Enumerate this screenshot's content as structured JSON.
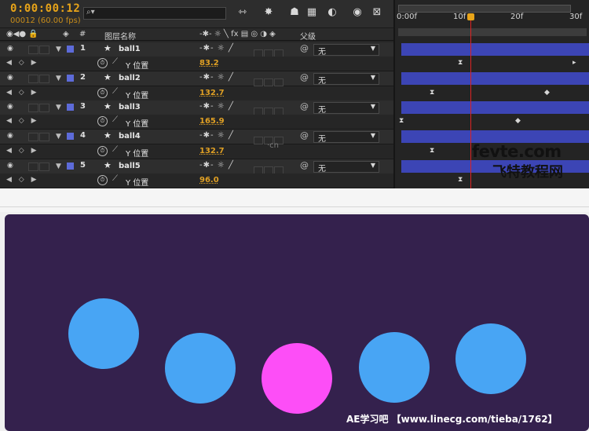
{
  "timecode": "0:00:00:12",
  "timecode_sub": "00012 (60.00 fps)",
  "search_placeholder": "⌕▾",
  "columns": {
    "number": "#",
    "layer_name": "图层名称",
    "parent": "父级"
  },
  "layers": [
    {
      "index": "1",
      "name": "ball1",
      "parent": "无",
      "property": "Y 位置",
      "value": "83.2"
    },
    {
      "index": "2",
      "name": "ball2",
      "parent": "无",
      "property": "Y 位置",
      "value": "132.7"
    },
    {
      "index": "3",
      "name": "ball3",
      "parent": "无",
      "property": "Y 位置",
      "value": "165.9"
    },
    {
      "index": "4",
      "name": "ball4",
      "parent": "无",
      "property": "Y 位置",
      "value": "132.7"
    },
    {
      "index": "5",
      "name": "ball5",
      "parent": "无",
      "property": "Y 位置",
      "value": "96.0"
    }
  ],
  "ruler": {
    "t0": "0:00f",
    "t1": "10f",
    "t2": "20f",
    "t3": "30f"
  },
  "watermark": {
    "line1": "fevte.com",
    "line2": "飞特教程网",
    "center": "·cn"
  },
  "stage_footer": "AE学习吧  【www.linecg.com/tieba/1762】",
  "colors": {
    "stage_bg": "#34214d",
    "ball_blue": "#48a5f4",
    "ball_pink": "#fd4ef7",
    "layer_bar": "#3c45b5",
    "timecode": "#e8a419"
  },
  "balls": [
    {
      "color": "blue"
    },
    {
      "color": "blue"
    },
    {
      "color": "pink"
    },
    {
      "color": "blue"
    },
    {
      "color": "blue"
    }
  ]
}
